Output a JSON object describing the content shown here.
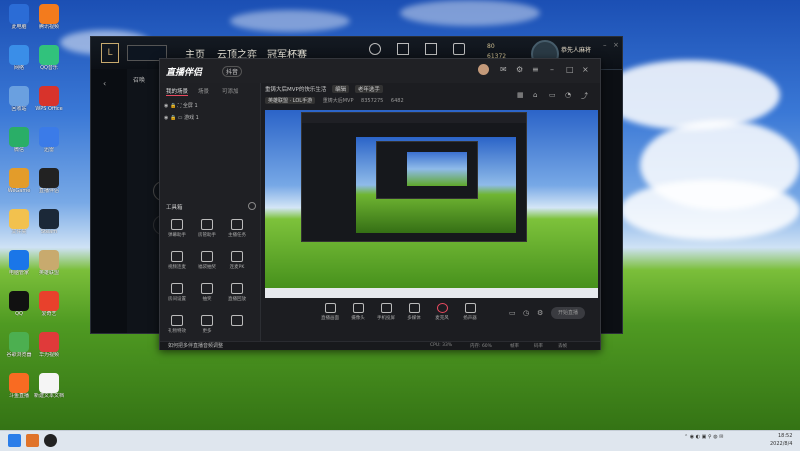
{
  "desktop": {
    "icons": [
      {
        "label": "此电脑",
        "color": "#2b6cd6"
      },
      {
        "label": "腾讯视频",
        "color": "#f37b1d"
      },
      {
        "label": "网络",
        "color": "#3a8ee8"
      },
      {
        "label": "QQ音乐",
        "color": "#31c27c"
      },
      {
        "label": "回收站",
        "color": "#6aa0e0"
      },
      {
        "label": "WPS Office",
        "color": "#d8332b"
      },
      {
        "label": "微信",
        "color": "#2aae67"
      },
      {
        "label": "迅雷",
        "color": "#3b7be8"
      },
      {
        "label": "WeGame",
        "color": "#e39c2a"
      },
      {
        "label": "直播伴侣",
        "color": "#222"
      },
      {
        "label": "文件夹",
        "color": "#f2c14e"
      },
      {
        "label": "Steam",
        "color": "#1b2838"
      },
      {
        "label": "电脑管家",
        "color": "#1a76e8"
      },
      {
        "label": "英雄联盟",
        "color": "#c8aa6e"
      },
      {
        "label": "QQ",
        "color": "#111"
      },
      {
        "label": "爱奇艺",
        "color": "#e8412c"
      },
      {
        "label": "谷歌浏览器",
        "color": "#4caf50"
      },
      {
        "label": "华为视频",
        "color": "#e03a3a"
      },
      {
        "label": "斗鱼直播",
        "color": "#f96b22"
      },
      {
        "label": "新建文本文档",
        "color": "#f5f5f5"
      }
    ]
  },
  "lol_client": {
    "nav": [
      "主页",
      "云顶之弈",
      "冠军杯赛"
    ],
    "icons": [
      "生涯",
      "藏品",
      "战利品",
      "商店"
    ],
    "currency": {
      "be": "80",
      "rp": "61372"
    },
    "summoner": "恭先人麻将",
    "panel_label": "召唤"
  },
  "streaming_app": {
    "logo": "直播伴侣",
    "badge": "抖音",
    "tabs": [
      "我的场景",
      "场景",
      "可添加"
    ],
    "scenes": [
      "全屏 1",
      "游戏 1"
    ],
    "tools_title": "工具箱",
    "tools": [
      "弹幕助手",
      "房管助手",
      "主播任务",
      "视频连麦",
      "福袋抽奖",
      "连麦PK",
      "房间设置",
      "抽奖",
      "直播回放",
      "礼物特效",
      "更多",
      ""
    ],
    "stream_title": "重铸大后MVP的快乐生活",
    "title_tag": "编辑",
    "title_tag2": "老年选手",
    "category": "英雄联盟 · LOL手游",
    "subtitle_fields": [
      "重铸大后MVP",
      "8357275",
      "6482"
    ],
    "bottom_tools": [
      "直播画面",
      "摄像头",
      "手机投屏",
      "多媒体",
      "麦克风",
      "扬声器"
    ],
    "go_live": "开始直播",
    "status_msg": "如何把多伴直播音频调整",
    "status_items": [
      "CPU: 33%",
      "内存: 60%",
      "帧率",
      "码率",
      "丢帧"
    ]
  },
  "taskbar": {
    "time": "18:52",
    "date": "2022/8/4"
  }
}
